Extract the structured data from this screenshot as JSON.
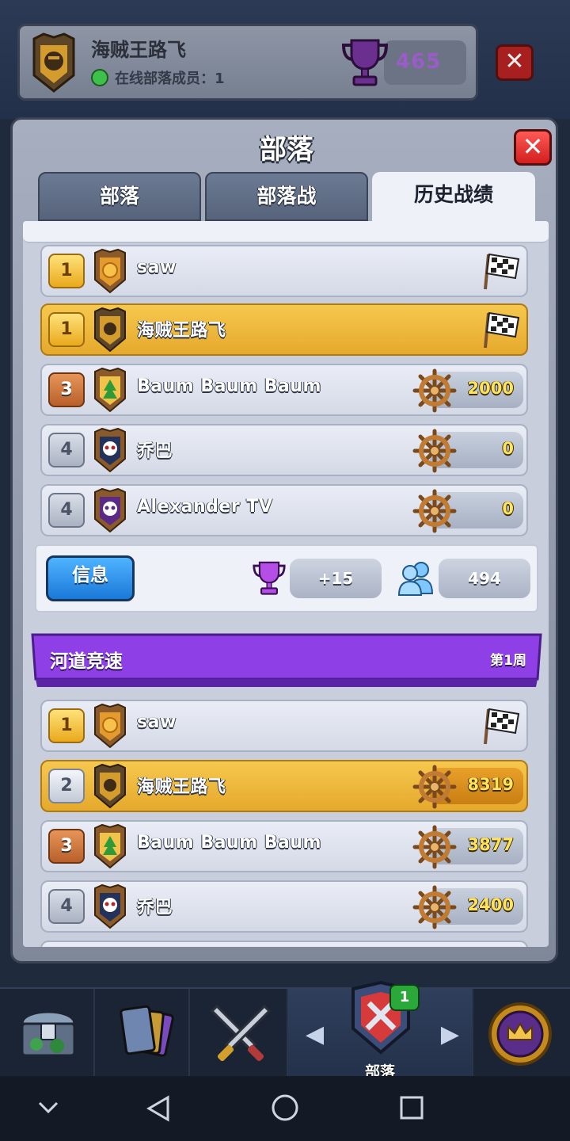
{
  "header": {
    "clan_name": "海贼王路飞",
    "online_label": "在线部落成员：1",
    "trophies": "465"
  },
  "modal": {
    "title": "部落",
    "tabs": [
      {
        "label": "部落",
        "active": false
      },
      {
        "label": "部落战",
        "active": false
      },
      {
        "label": "历史战绩",
        "active": true
      }
    ]
  },
  "race_1": {
    "rows": [
      {
        "rank": "1",
        "name": "saw",
        "score": null,
        "finished": true,
        "mine": false
      },
      {
        "rank": "1",
        "name": "海贼王路飞",
        "score": null,
        "finished": true,
        "mine": true
      },
      {
        "rank": "3",
        "name": "Baum Baum Baum",
        "score": "2000",
        "finished": false,
        "mine": false
      },
      {
        "rank": "4",
        "name": "乔巴",
        "score": "0",
        "finished": false,
        "mine": false
      },
      {
        "rank": "4",
        "name": "Alexander TV",
        "score": "0",
        "finished": false,
        "mine": false
      }
    ],
    "info_button": "信息",
    "trophy_change": "+15",
    "members": "494"
  },
  "race_2": {
    "title": "河道竞速",
    "week": "第1周",
    "rows": [
      {
        "rank": "1",
        "name": "saw",
        "score": null,
        "finished": true,
        "mine": false
      },
      {
        "rank": "2",
        "name": "海贼王路飞",
        "score": "8319",
        "finished": false,
        "mine": true
      },
      {
        "rank": "3",
        "name": "Baum Baum Baum",
        "score": "3877",
        "finished": false,
        "mine": false
      },
      {
        "rank": "4",
        "name": "乔巴",
        "score": "2400",
        "finished": false,
        "mine": false
      }
    ]
  },
  "bottom_nav": {
    "items": [
      {
        "icon": "chest-icon"
      },
      {
        "icon": "cards-icon"
      },
      {
        "icon": "battle-swords-icon"
      },
      {
        "icon": "clan-shield-icon",
        "label": "部落",
        "badge": "1"
      },
      {
        "icon": "tournament-crown-icon"
      }
    ]
  },
  "colors": {
    "accent_purple": "#8f3fe6",
    "my_row": "#f2c04a",
    "close_red": "#e42b2b"
  }
}
